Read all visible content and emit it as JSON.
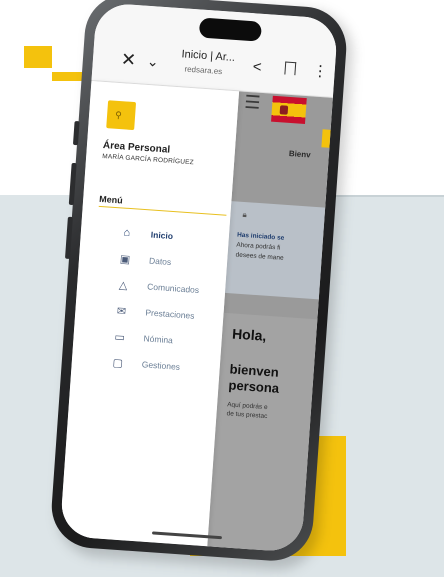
{
  "browser": {
    "tab_title": "Inicio | Ar...",
    "url": "redsara.es",
    "icons": [
      "close-icon",
      "chevron-down-icon",
      "share-icon",
      "bookmark-icon",
      "more-icon"
    ]
  },
  "sidebar": {
    "area_title": "Área Personal",
    "user_name": "MARÍA GARCÍA RODRÍGUEZ",
    "menu_title": "Menú",
    "items": [
      {
        "label": "Inicio",
        "icon": "home-icon",
        "active": true
      },
      {
        "label": "Datos",
        "icon": "id-card-icon",
        "active": false
      },
      {
        "label": "Comunicados",
        "icon": "bell-icon",
        "active": false
      },
      {
        "label": "Prestaciones",
        "icon": "mail-icon",
        "active": false
      },
      {
        "label": "Nómina",
        "icon": "wallet-icon",
        "active": false
      },
      {
        "label": "Gestiones",
        "icon": "folder-icon",
        "active": false
      }
    ]
  },
  "main": {
    "header_text": "Bienv",
    "notice": {
      "title": "Has iniciado se",
      "line1": "Ahora podrás fi",
      "line2": "desees de mane"
    },
    "greeting": "Hola,",
    "welcome_line1": "bienven",
    "welcome_line2": "persona",
    "desc_line1": "Aquí podrás e",
    "desc_line2": "de tus prestac"
  },
  "colors": {
    "accent": "#f4c20d",
    "nav_active": "#1f3d6e",
    "nav_text": "#6a7e95",
    "background_panel": "#dde5e8"
  }
}
